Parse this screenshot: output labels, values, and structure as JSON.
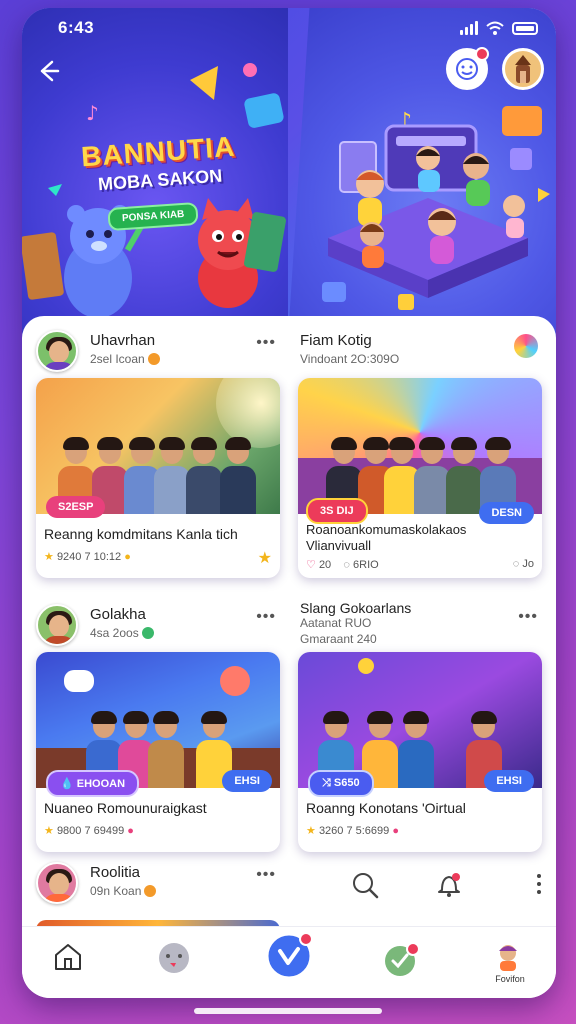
{
  "status_bar": {
    "time": "6:43"
  },
  "hero": {
    "title_line1": "BANNUTIA",
    "title_line2": "MOBA SAKON",
    "pill_label": "PONSA KIAB"
  },
  "posts": [
    {
      "author": "Uhavrhan",
      "meta": "2sel Icoan",
      "tag": "S2ESP",
      "title": "Reanng komdmitans Kanla tich",
      "stats": "9240 7 10:12"
    },
    {
      "author": "Fiam Kotig",
      "meta": "Vindoant 2O:309O",
      "tag": "DESN",
      "badge": "3S DIJ",
      "title": "Roanoankomumaskolakaos",
      "title2": "Vlianvivuall",
      "stats_left": "20",
      "stats_mid": "6RIO",
      "stats_right": "Jo"
    },
    {
      "author": "Golakha",
      "meta": "4sa 2oos",
      "tag": "EHOOAN",
      "tag_right": "EHSI",
      "title": "Nuaneo Romounuraigkast",
      "stats": "9800 7 69499"
    },
    {
      "author": "Slang Gokoarlans",
      "meta": "Aatanat RUO",
      "meta2": "Gmaraant 240",
      "tag": "S650",
      "tag_right": "EHSI",
      "title": "Roanng Konotans 'Oirtual",
      "stats": "3260 7 5:6699"
    },
    {
      "author": "Roolitia",
      "meta": "09n Koan"
    }
  ],
  "nav": {
    "profile_label": "Fovifon"
  },
  "colors": {
    "accent": "#4a5cf0",
    "tag_pink": "#e8407c",
    "tag_blue": "#3f6df0",
    "tag_purple": "#8a4ff0",
    "badge_red": "#ec3b5a"
  }
}
